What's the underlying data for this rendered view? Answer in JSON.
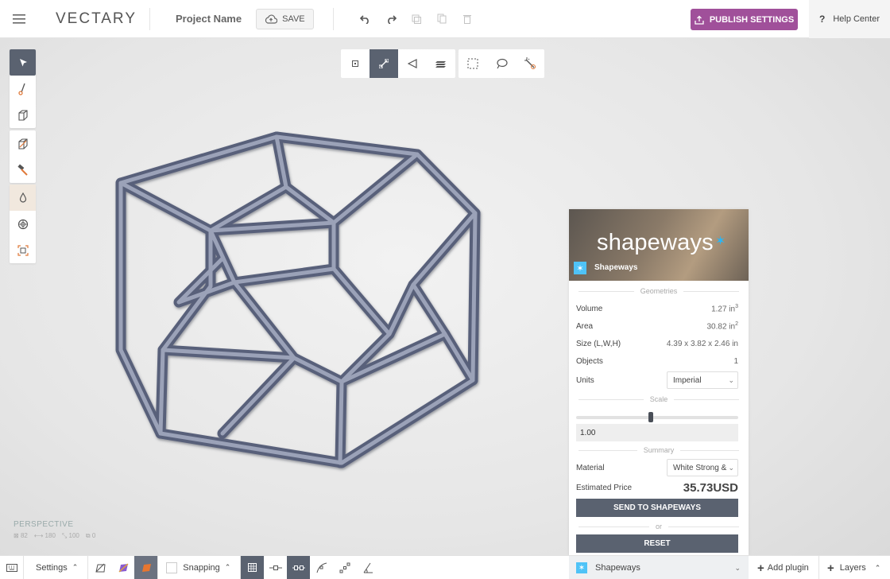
{
  "app": {
    "logo": "VECTARY",
    "project_name": "Project Name",
    "save_label": "SAVE"
  },
  "header": {
    "publish_label": "PUBLISH SETTINGS",
    "help_label": "Help Center",
    "help_glyph": "?"
  },
  "left_toolbar": [
    {
      "group": 1,
      "items": [
        "select-arrow-icon",
        "pen-tool-icon",
        "cube-icon"
      ]
    },
    {
      "group": 2,
      "items": [
        "cube-edit-icon",
        "hammer-icon"
      ]
    },
    {
      "group": 3,
      "items": [
        "droplet-icon",
        "sphere-icon",
        "frame-icon"
      ]
    }
  ],
  "selection_toolbar": [
    "vertex-icon",
    "edge-icon",
    "face-icon",
    "object-layers-icon",
    "box-select-icon",
    "lasso-icon",
    "magic-wand-icon"
  ],
  "viewport": {
    "camera": "PERSPECTIVE",
    "stats": {
      "faces": "82",
      "edges": "180",
      "vertices": "100",
      "objects": "0"
    }
  },
  "panel": {
    "brand_logo": "shapeways",
    "brand_name": "Shapeways",
    "section_geometries": "Geometries",
    "volume_label": "Volume",
    "volume_value": "1.27 in",
    "volume_exp": "3",
    "area_label": "Area",
    "area_value": "30.82 in",
    "area_exp": "2",
    "size_label": "Size (L,W,H)",
    "size_value": "4.39 x 3.82 x 2.46 in",
    "objects_label": "Objects",
    "objects_value": "1",
    "units_label": "Units",
    "units_value": "Imperial",
    "section_scale": "Scale",
    "scale_value": "1.00",
    "scale_fraction": 0.46,
    "section_summary": "Summary",
    "material_label": "Material",
    "material_value": "White Strong &",
    "price_label": "Estimated Price",
    "price_value": "35.73USD",
    "send_label": "SEND TO SHAPEWAYS",
    "or_label": "or",
    "reset_label": "RESET"
  },
  "bottom": {
    "settings_label": "Settings",
    "snapping_label": "Snapping",
    "plugin_label": "Shapeways",
    "add_plugin_label": "Add plugin",
    "layers_label": "Layers"
  },
  "colors": {
    "accent": "#a0509a",
    "dark": "#5a6270",
    "shapeways_blue": "#4fc3f7",
    "model": "#6c7385"
  }
}
